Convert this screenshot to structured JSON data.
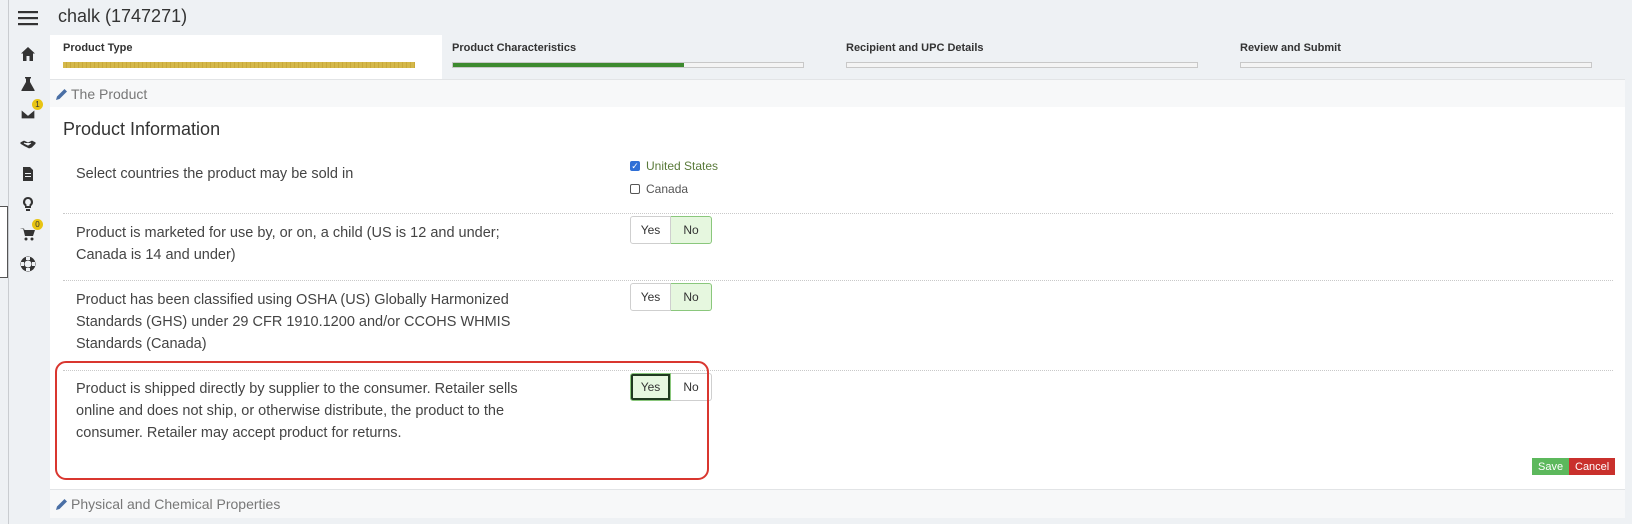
{
  "app": {
    "title": "chalk (1747271)"
  },
  "rail": {
    "items": [
      {
        "icon": "menu-icon"
      },
      {
        "icon": "home-icon"
      },
      {
        "icon": "flask-icon"
      },
      {
        "icon": "mail-icon",
        "badge": "1"
      },
      {
        "icon": "handshake-icon"
      },
      {
        "icon": "document-icon"
      },
      {
        "icon": "lightbulb-icon"
      },
      {
        "icon": "cart-icon",
        "badge": "0"
      },
      {
        "icon": "lifebuoy-icon"
      }
    ]
  },
  "steps": [
    {
      "label": "Product Type",
      "progress": 1.0,
      "color": "#d4b84a"
    },
    {
      "label": "Product Characteristics",
      "progress": 0.66,
      "color": "#3d8a2f"
    },
    {
      "label": "Recipient and UPC Details",
      "progress": 0,
      "color": "#3d8a2f"
    },
    {
      "label": "Review and Submit",
      "progress": 0,
      "color": "#3d8a2f"
    }
  ],
  "sections": {
    "the_product": "The Product",
    "physical": "Physical and Chemical Properties"
  },
  "panel": {
    "title": "Product Information",
    "countries_q": "Select countries the product may be sold in",
    "countries": [
      {
        "label": "United States",
        "checked": true
      },
      {
        "label": "Canada",
        "checked": false
      }
    ],
    "questions": [
      {
        "text": "Product is marketed for use by, or on, a child (US is 12 and under; Canada is 14 and under)",
        "yes": "Yes",
        "no": "No",
        "selected": "No"
      },
      {
        "text": "Product has been classified using OSHA (US) Globally Harmonized Standards (GHS) under 29 CFR 1910.1200 and/or CCOHS WHMIS Standards (Canada)",
        "yes": "Yes",
        "no": "No",
        "selected": "No"
      },
      {
        "text": "Product is shipped directly by supplier to the consumer. Retailer sells online and does not ship, or otherwise distribute, the product to the consumer. Retailer may accept product for returns.",
        "yes": "Yes",
        "no": "No",
        "selected": "Yes"
      }
    ],
    "save": "Save",
    "cancel": "Cancel"
  },
  "colors": {
    "save": "#5cb85c",
    "cancel": "#c9302c",
    "highlight": "#d9362f"
  }
}
